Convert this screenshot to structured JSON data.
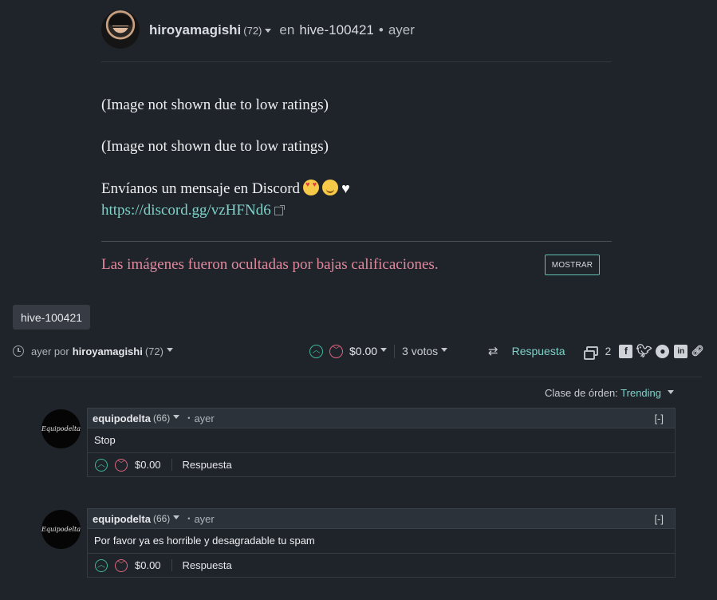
{
  "post": {
    "author": "hiroyamagishi",
    "author_rep": "(72)",
    "in_label": "en",
    "community": "hive-100421",
    "bullet": "•",
    "time": "ayer",
    "body": {
      "line1": "(Image not shown due to low ratings)",
      "line2": "(Image not shown due to low ratings)",
      "line3": "Envíanos un mensaje en Discord",
      "link": "https://discord.gg/vzHFNd6"
    },
    "hidden_notice": "Las imágenes fueron ocultadas por bajas calificaciones.",
    "show_button": "MOSTRAR",
    "tag": "hive-100421"
  },
  "footer": {
    "time": "ayer por",
    "author": "hiroyamagishi",
    "author_rep": "(72)",
    "payout": "$0.00",
    "votes": "3 votos",
    "reply": "Respuesta",
    "comment_count": "2",
    "share_icons": [
      "facebook-icon",
      "twitter-icon",
      "reddit-icon",
      "linkedin-icon",
      "link-icon"
    ]
  },
  "sort": {
    "label": "Clase de órden:",
    "value": "Trending"
  },
  "comments": [
    {
      "avatar_text": "Equipodelta",
      "author": "equipodelta",
      "rep": "(66)",
      "time": "ayer",
      "collapse": "[-]",
      "text": "Stop",
      "payout": "$0.00",
      "reply": "Respuesta"
    },
    {
      "avatar_text": "Equipodelta",
      "author": "equipodelta",
      "rep": "(66)",
      "time": "ayer",
      "collapse": "[-]",
      "text": "Por favor ya es horrible y desagradable tu spam",
      "payout": "$0.00",
      "reply": "Respuesta"
    }
  ],
  "colors": {
    "background": "#1f232a",
    "accent": "#7dd3c8",
    "upvote": "#3fb79f",
    "downvote": "#d9667e",
    "hidden_notice": "#e2899d"
  }
}
